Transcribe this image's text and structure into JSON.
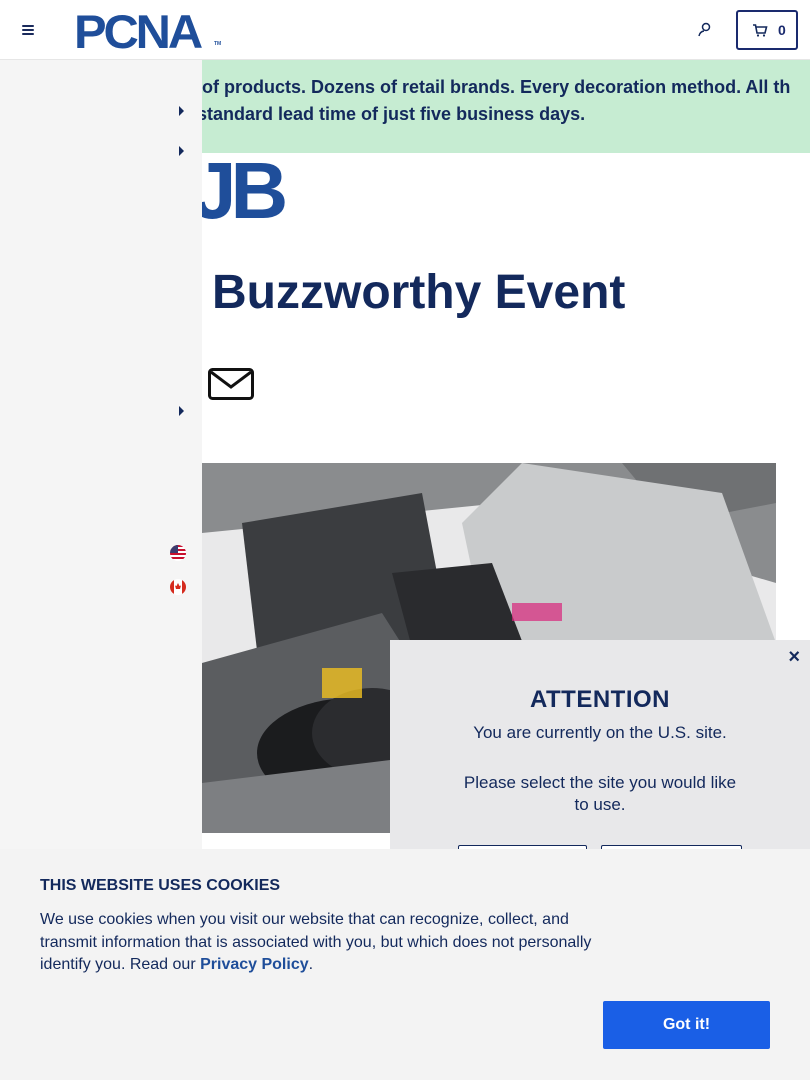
{
  "header": {
    "logo_text": "PCNA",
    "logo_tm": "TM",
    "cart_count": "0"
  },
  "banner": {
    "text": "ls of products. Dozens of retail brands. Every decoration method. All th a standard lead time of just five business days."
  },
  "article": {
    "hub_fragment": "JB",
    "title": "Buzzworthy Event"
  },
  "sidebar": {
    "flags": [
      "us-flag-icon",
      "canada-flag-icon"
    ]
  },
  "attention": {
    "close": "×",
    "title": "ATTENTION",
    "message": "You are currently on the U.S. site.",
    "prompt": "Please select the site you would like to use."
  },
  "cookie": {
    "title": "THIS WEBSITE USES COOKIES",
    "body_prefix": "We use cookies when you visit our website that can recognize, collect, and transmit information that is associated with you, but which does not personally identify you. Read our ",
    "link": "Privacy Policy",
    "body_suffix": ".",
    "button": "Got it!"
  },
  "colors": {
    "navy": "#13295c",
    "brand_blue": "#1f4e9a",
    "banner_green": "#c6ecd2",
    "cta_blue": "#1a5fe6"
  }
}
